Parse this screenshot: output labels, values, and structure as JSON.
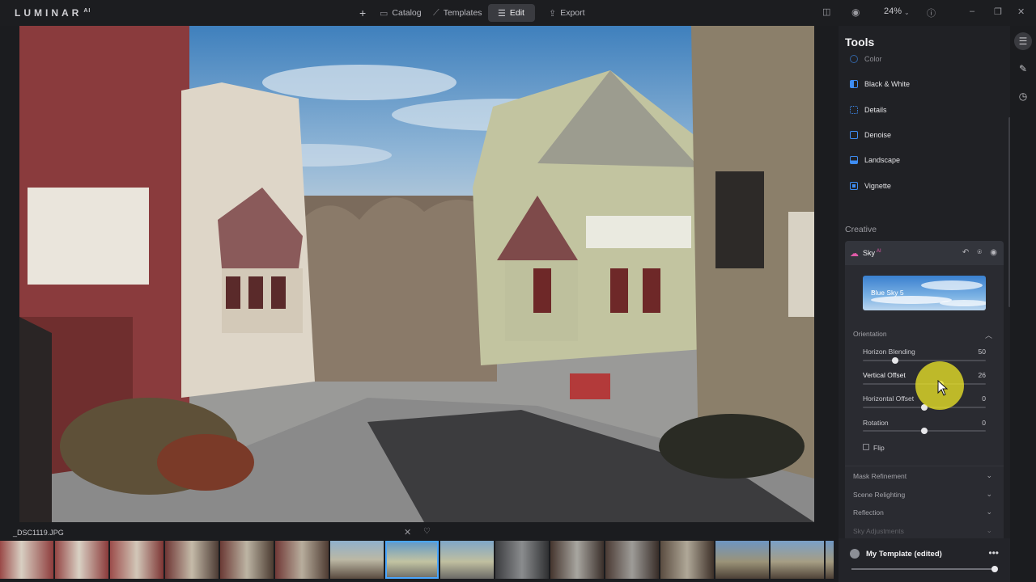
{
  "app": {
    "logo": "LUMINAR",
    "logo_sup": "AI"
  },
  "nav": {
    "add": "+",
    "catalog": "Catalog",
    "templates": "Templates",
    "edit": "Edit",
    "export": "Export"
  },
  "topright": {
    "zoom": "24%"
  },
  "photo": {
    "filename": "_DSC1119.JPG"
  },
  "panel": {
    "title": "Tools",
    "tools": [
      {
        "label": "Color"
      },
      {
        "label": "Black & White"
      },
      {
        "label": "Details"
      },
      {
        "label": "Denoise"
      },
      {
        "label": "Landscape"
      },
      {
        "label": "Vignette"
      }
    ],
    "creative_label": "Creative",
    "sky": {
      "title": "Sky",
      "ai_badge": "AI",
      "preset": "Blue Sky 5",
      "orientation_label": "Orientation",
      "sliders": [
        {
          "label": "Horizon Blending",
          "value": "50",
          "fraction": 0.26
        },
        {
          "label": "Vertical Offset",
          "value": "26",
          "fraction": 0.63
        },
        {
          "label": "Horizontal Offset",
          "value": "0",
          "fraction": 0.5
        },
        {
          "label": "Rotation",
          "value": "0",
          "fraction": 0.5
        }
      ],
      "flip_label": "Flip",
      "collapsed_sections": [
        "Mask Refinement",
        "Scene Relighting",
        "Reflection",
        "Sky Adjustments"
      ]
    },
    "template": {
      "name": "My Template (edited)",
      "more": "•••",
      "amount": 1.0
    }
  },
  "colors": {
    "accent": "#3e8df3",
    "selected_thumb": "#4aa7ff",
    "highlight": "#e8e128"
  }
}
